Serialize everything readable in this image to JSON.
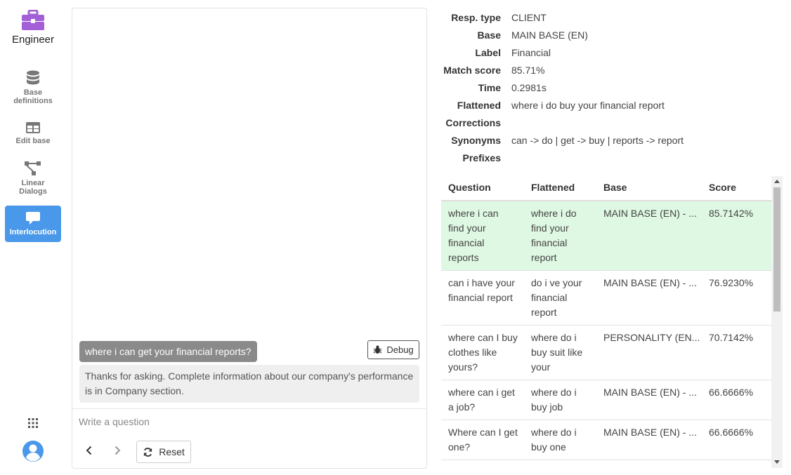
{
  "brand": {
    "label": "Engineer",
    "accent": "#a35fd6"
  },
  "sidebar": {
    "items": [
      {
        "label_lines": [
          "Base",
          "definitions"
        ],
        "icon": "database-icon"
      },
      {
        "label_lines": [
          "Edit base"
        ],
        "icon": "table-icon"
      },
      {
        "label_lines": [
          "Linear",
          "Dialogs"
        ],
        "icon": "flow-icon"
      },
      {
        "label_lines": [
          "Interlocution"
        ],
        "icon": "chat-icon",
        "active": true
      }
    ]
  },
  "chat": {
    "user_message": "where i can get your financial reports?",
    "debug_label": "Debug",
    "bot_message": "Thanks for asking. Complete information about our company's performance is in Company section.",
    "input_placeholder": "Write a question",
    "reset_label": "Reset"
  },
  "info": {
    "rows": [
      {
        "key": "Resp. type",
        "value": "CLIENT"
      },
      {
        "key": "Base",
        "value": "MAIN BASE (EN)"
      },
      {
        "key": "Label",
        "value": "Financial"
      },
      {
        "key": "Match score",
        "value": "85.71%"
      },
      {
        "key": "Time",
        "value": "0.2981s"
      },
      {
        "key": "Flattened",
        "value": "where i do buy your financial report"
      },
      {
        "key": "Corrections",
        "value": ""
      },
      {
        "key": "Synonyms",
        "value": "can -> do | get -> buy | reports -> report"
      },
      {
        "key": "Prefixes",
        "value": ""
      }
    ]
  },
  "table": {
    "headers": [
      "Question",
      "Flattened",
      "Base",
      "Score"
    ],
    "rows": [
      {
        "question": [
          "where i can",
          "find your",
          "financial",
          "reports"
        ],
        "flattened": [
          "where i do",
          "find your",
          "financial",
          "report"
        ],
        "base": "MAIN BASE (EN) - ...",
        "score": "85.7142%",
        "highlight": true
      },
      {
        "question": [
          "can i have your",
          "financial report"
        ],
        "flattened": [
          "do i ve your",
          "financial",
          "report"
        ],
        "base": "MAIN BASE (EN) - ...",
        "score": "76.9230%"
      },
      {
        "question": [
          "where can I buy",
          "clothes like",
          "yours?"
        ],
        "flattened": [
          "where do i",
          "buy suit like",
          "your"
        ],
        "base": "PERSONALITY (EN...",
        "score": "70.7142%"
      },
      {
        "question": [
          "where can i get",
          "a job?"
        ],
        "flattened": [
          "where do i",
          "buy job"
        ],
        "base": "MAIN BASE (EN) - ...",
        "score": "66.6666%"
      },
      {
        "question": [
          "Where can I get",
          "one?"
        ],
        "flattened": [
          "where do i",
          "buy one"
        ],
        "base": "MAIN BASE (EN) - ...",
        "score": "66.6666%"
      }
    ],
    "highlight_color": "#dff8e3"
  }
}
